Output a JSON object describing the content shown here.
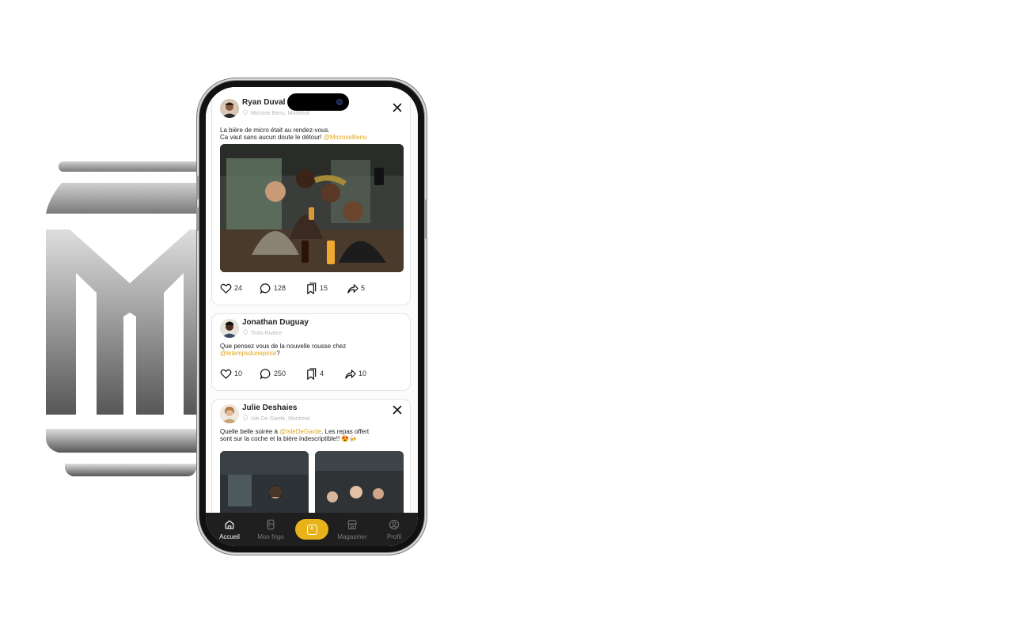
{
  "colors": {
    "accent": "#e8b31a",
    "mention": "#e2a71b",
    "tabbar_bg": "#1f1f1f",
    "logo_gradient": [
      "#e0e0e0",
      "#5a5a5a"
    ]
  },
  "posts": [
    {
      "author": "Ryan Duval",
      "location": "Microse Benu, Montréal",
      "text_line1": "La bière de micro était au rendez-vous.",
      "text_line2": "Ca vaut sans aucun doute le détour!",
      "mention": "@MicroseBenu",
      "likes": "24",
      "comments": "128",
      "saves": "15",
      "shares": "5",
      "has_close": true,
      "icons": [
        "heart-icon",
        "comment-icon",
        "bookmark-icon",
        "share-icon",
        "close-icon"
      ]
    },
    {
      "author": "Jonathan Duguay",
      "location": "Trois-Rivière",
      "text_line1": "Que pensez vous de la nouvelle rousse chez",
      "mention": "@letempsdunepinte",
      "text_after": "?",
      "likes": "10",
      "comments": "250",
      "saves": "4",
      "shares": "10"
    },
    {
      "author": "Julie Deshaies",
      "location": "Isle De Garde, Montréal",
      "text_before": "Quelle belle soirée à",
      "mention": "@IsleDeGarde",
      "text_line1_rest": ". Les repas offert",
      "text_line2": "sont sur la coche et la bière indescriptible!! 😍🍻",
      "has_close": true
    }
  ],
  "tabbar": {
    "tabs": [
      {
        "label": "Accueil",
        "icon": "home-icon",
        "active": true
      },
      {
        "label": "Mon frigo",
        "icon": "fridge-icon",
        "active": false
      },
      {
        "label": "Magasiner",
        "icon": "store-icon",
        "active": false
      },
      {
        "label": "Profil",
        "icon": "profile-icon",
        "active": false
      }
    ],
    "add_icon": "plus-square-icon"
  }
}
